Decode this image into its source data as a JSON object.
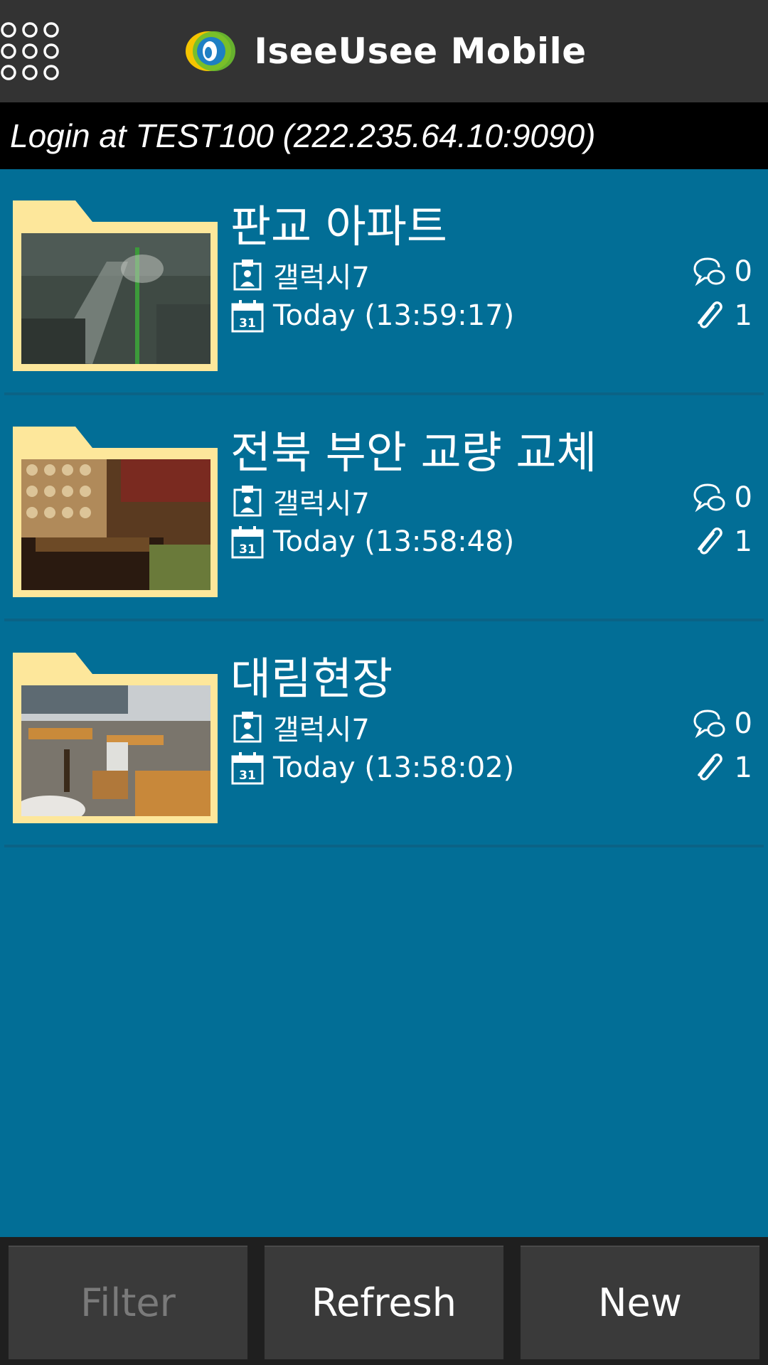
{
  "header": {
    "app_title": "IseeUsee Mobile",
    "menu_icon": "grid-menu-icon",
    "logo_icon": "iseeusee-logo"
  },
  "login": {
    "text": "Login at TEST100 (222.235.64.10:9090)"
  },
  "items": [
    {
      "title": "판교 아파트",
      "author": "갤럭시7",
      "date": "Today (13:59:17)",
      "comments": "0",
      "attachments": "1",
      "thumb": "photo-thumbnail"
    },
    {
      "title": "전북 부안 교량 교체",
      "author": "갤럭시7",
      "date": "Today (13:58:48)",
      "comments": "0",
      "attachments": "1",
      "thumb": "photo-thumbnail"
    },
    {
      "title": "대림현장",
      "author": "갤럭시7",
      "date": "Today (13:58:02)",
      "comments": "0",
      "attachments": "1",
      "thumb": "photo-thumbnail"
    }
  ],
  "buttons": {
    "filter": "Filter",
    "refresh": "Refresh",
    "new": "New"
  },
  "colors": {
    "background": "#026e96",
    "appbar": "#333333",
    "folder": "#fde79b",
    "button": "#3a3a3a",
    "disabled_text": "#7a7a7a"
  }
}
